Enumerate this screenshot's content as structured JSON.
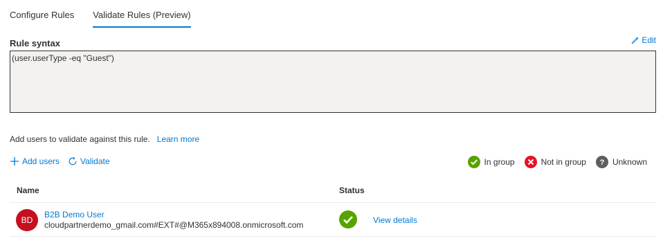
{
  "tabs": [
    {
      "label": "Configure Rules"
    },
    {
      "label": "Validate Rules (Preview)"
    }
  ],
  "rule_syntax": {
    "label": "Rule syntax",
    "edit_label": "Edit",
    "value": "(user.userType -eq \"Guest\")"
  },
  "validate": {
    "description": "Add users to validate against this rule.",
    "learn_more": "Learn more",
    "add_users_label": "Add users",
    "validate_label": "Validate"
  },
  "legend": {
    "in_group": "In group",
    "not_in_group": "Not in group",
    "unknown": "Unknown"
  },
  "colors": {
    "accent": "#0078d4",
    "in_group": "#57a300",
    "not_in_group": "#e81123",
    "unknown": "#605e5c",
    "avatar": "#c50f1f"
  },
  "table": {
    "columns": [
      "Name",
      "Status"
    ],
    "rows": [
      {
        "avatar_initials": "BD",
        "name": "B2B Demo User",
        "email": "cloudpartnerdemo_gmail.com#EXT#@M365x894008.onmicrosoft.com",
        "status": "In group",
        "status_icon": "checkmark-circle-icon",
        "action": "View details"
      }
    ]
  }
}
